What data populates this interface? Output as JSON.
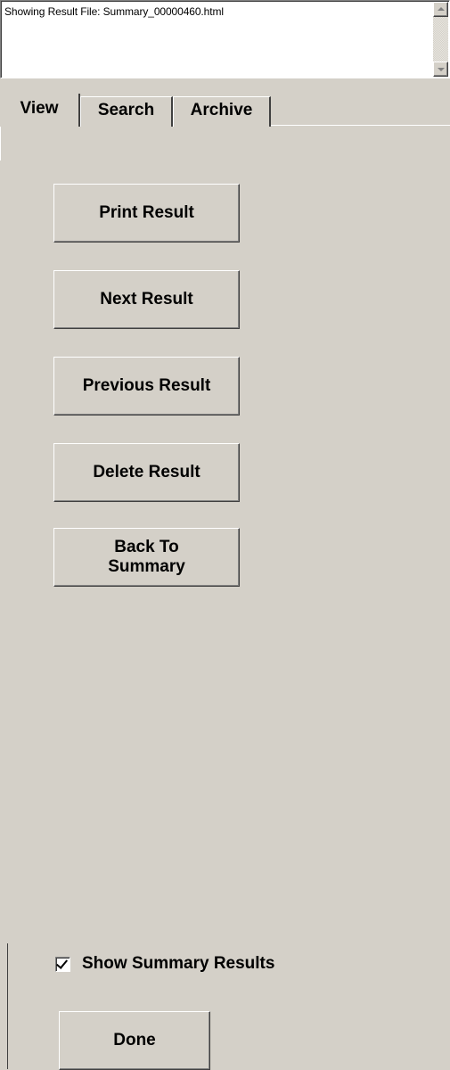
{
  "status": {
    "text": "Showing Result File: Summary_00000460.html"
  },
  "tabs": [
    {
      "label": "View",
      "active": true
    },
    {
      "label": "Search",
      "active": false
    },
    {
      "label": "Archive",
      "active": false
    }
  ],
  "view_panel": {
    "print_label": "Print Result",
    "next_label": "Next Result",
    "previous_label": "Previous Result",
    "delete_label": "Delete Result",
    "back_label": "Back To Summary"
  },
  "options": {
    "show_summary_label": "Show Summary Results",
    "show_summary_checked": true
  },
  "footer": {
    "done_label": "Done"
  },
  "icons": {
    "scroll_up": "arrow-up-icon",
    "scroll_down": "arrow-down-icon",
    "checkmark": "checkmark-icon"
  }
}
